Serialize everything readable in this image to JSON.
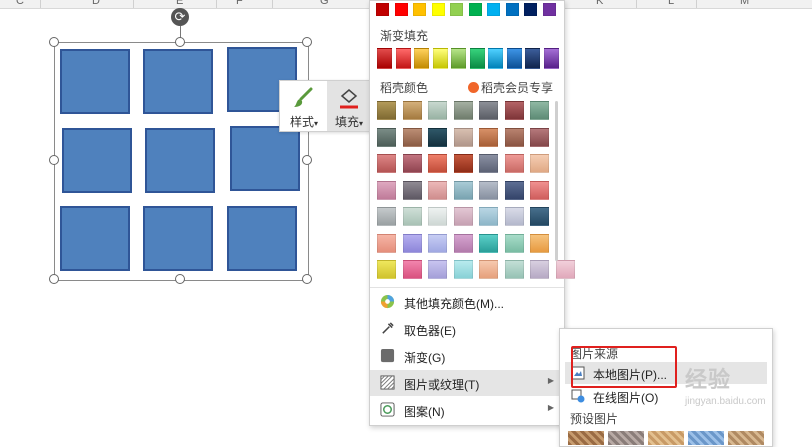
{
  "sheet": {
    "column_headers": [
      "C",
      "D",
      "E",
      "F",
      "G",
      "",
      "K",
      "L",
      "M"
    ]
  },
  "mini_toolbar": {
    "style_label": "样式",
    "fill_label": "填充",
    "dropdown_arrow": "▾"
  },
  "fill_panel": {
    "top_row_colors": [
      "#c00000",
      "#ff0000",
      "#ffc000",
      "#ffff00",
      "#92d050",
      "#00b050",
      "#00b0f0",
      "#0070c0",
      "#002060",
      "#7030a0"
    ],
    "gradient_title": "渐变填充",
    "gradient_row": [
      [
        "#e24c4c",
        "#a80000"
      ],
      [
        "#ff6a6a",
        "#c21515"
      ],
      [
        "#ffd15c",
        "#c28a00"
      ],
      [
        "#ffff7a",
        "#c5c500"
      ],
      [
        "#b7e58a",
        "#5d9b28"
      ],
      [
        "#37d37c",
        "#0a8a43"
      ],
      [
        "#4fd0ff",
        "#0081b8"
      ],
      [
        "#3d94e6",
        "#0b4f95"
      ],
      [
        "#3c5d9b",
        "#10244d"
      ],
      [
        "#a56fd6",
        "#57208a"
      ]
    ],
    "daoke_title": "稻壳颜色",
    "vip_label": "稻壳会员专享",
    "daoke_rows": [
      [
        [
          "#b39a59",
          "#7f6a32"
        ],
        [
          "#d4b07b",
          "#a47a3f"
        ],
        [
          "#c8d8cf",
          "#98b2a3"
        ],
        [
          "#a5b0a2",
          "#6f7c6c"
        ],
        [
          "#8c8f97",
          "#5b5e66"
        ],
        [
          "#b46366",
          "#7e3538"
        ],
        [
          "#8fb8a3",
          "#5d8b75"
        ]
      ],
      [
        [
          "#7a8c86",
          "#4d5e58"
        ],
        [
          "#bb8d74",
          "#8b5c44"
        ],
        [
          "#2f5768",
          "#14313e"
        ],
        [
          "#d8bfb0",
          "#b0968a"
        ],
        [
          "#d79067",
          "#a75f37"
        ],
        [
          "#b8826f",
          "#8a5442"
        ],
        [
          "#b5787b",
          "#84474a"
        ]
      ],
      [
        [
          "#dd8686",
          "#b45454"
        ],
        [
          "#c27480",
          "#8f4450"
        ],
        [
          "#ee7f6a",
          "#c14d39"
        ],
        [
          "#c6593e",
          "#8f2d18"
        ],
        [
          "#8a90a2",
          "#5c6275"
        ],
        [
          "#ee9a96",
          "#c96a65"
        ],
        [
          "#f5cdb3",
          "#e0a985"
        ]
      ],
      [
        [
          "#dfa8c0",
          "#bf7b99"
        ],
        [
          "#8f8a93",
          "#5e5863"
        ],
        [
          "#ecb8b8",
          "#cf8d8d"
        ],
        [
          "#a9cbd6",
          "#79a3b0"
        ],
        [
          "#b6bdc9",
          "#8790a0"
        ],
        [
          "#5d6e93",
          "#34446a"
        ],
        [
          "#f0908f",
          "#cf5d5c"
        ]
      ],
      [
        [
          "#c5cacc",
          "#9aa0a2"
        ],
        [
          "#cfdfd7",
          "#a8c2b5"
        ],
        [
          "#eef2f1",
          "#ced7d4"
        ],
        [
          "#e3c7d4",
          "#c6a0b2"
        ],
        [
          "#b9d6e4",
          "#8db6c8"
        ],
        [
          "#d9dbe8",
          "#b4b8cc"
        ],
        [
          "#476f8c",
          "#244862"
        ]
      ],
      [
        [
          "#f6b5a6",
          "#e58e7b"
        ],
        [
          "#b5aff0",
          "#8d86d9"
        ],
        [
          "#c7cdf4",
          "#a0a8e2"
        ],
        [
          "#d6a3cf",
          "#b27aab"
        ],
        [
          "#5bcfc8",
          "#2a9f99"
        ],
        [
          "#a8dcc9",
          "#79bca3"
        ],
        [
          "#f6c37e",
          "#e79a40"
        ]
      ],
      [
        [
          "#efe75d",
          "#d0c32d"
        ],
        [
          "#f284ad",
          "#d9517f"
        ],
        [
          "#c8c4f0",
          "#a49fd8"
        ],
        [
          "#b8ebee",
          "#88d1d6"
        ],
        [
          "#f6c9ae",
          "#e6a07b"
        ],
        [
          "#c3dfd6",
          "#96c2b4"
        ],
        [
          "#d8cfe0",
          "#b6a9c4"
        ],
        [
          "#f2d0db",
          "#e0a8ba"
        ]
      ]
    ],
    "menu": [
      {
        "icon": "color-wheel-icon",
        "label": "其他填充颜色(M)...",
        "arrow": ""
      },
      {
        "icon": "eyedropper-icon",
        "label": "取色器(E)",
        "arrow": ""
      },
      {
        "icon": "gradient-icon",
        "label": "渐变(G)",
        "arrow": ""
      },
      {
        "icon": "texture-icon",
        "label": "图片或纹理(T)",
        "arrow": "▶"
      },
      {
        "icon": "pattern-icon",
        "label": "图案(N)",
        "arrow": "▶"
      }
    ]
  },
  "submenu": {
    "source_title": "图片来源",
    "local_image": "本地图片(P)...",
    "online_image": "在线图片(O)",
    "preset_title": "预设图片",
    "textures": [
      [
        "#9a6b43",
        "#c79c6f"
      ],
      [
        "#8a7d79",
        "#b8aaa5"
      ],
      [
        "#c89a66",
        "#e3c08f"
      ],
      [
        "#6b97c9",
        "#9cc0e8"
      ],
      [
        "#b08a62",
        "#d8b890"
      ]
    ]
  },
  "watermark": {
    "text": "经验",
    "url": "jingyan.baidu.com"
  },
  "colors": {
    "shape_fill": "#4f81bd",
    "shape_border": "#2f5597",
    "highlight_box": "#e0201e"
  }
}
